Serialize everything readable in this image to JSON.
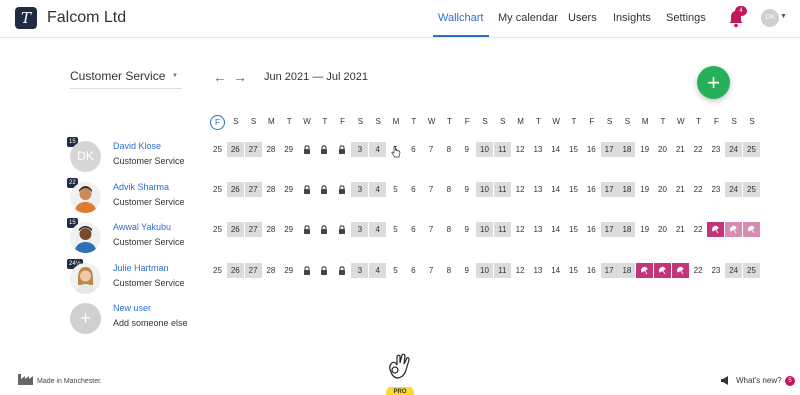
{
  "header": {
    "logo_letter": "T",
    "company": "Falcom Ltd",
    "nav": [
      {
        "label": "Wallchart",
        "active": true
      },
      {
        "label": "My calendar"
      },
      {
        "label": "Users"
      },
      {
        "label": "Insights"
      },
      {
        "label": "Settings"
      }
    ],
    "notifications_count": "4",
    "user_initials": "DK"
  },
  "controls": {
    "team": "Customer Service",
    "range": "Jun 2021 — Jul 2021"
  },
  "day_letters": [
    "F",
    "S",
    "S",
    "M",
    "T",
    "W",
    "T",
    "F",
    "S",
    "S",
    "M",
    "T",
    "W",
    "T",
    "F",
    "S",
    "S",
    "M",
    "T",
    "W",
    "T",
    "F",
    "S",
    "S",
    "M",
    "T",
    "W",
    "T",
    "F",
    "S",
    "S"
  ],
  "dates": [
    "25",
    "26",
    "27",
    "28",
    "29",
    "30",
    "1",
    "2",
    "3",
    "4",
    "5",
    "6",
    "7",
    "8",
    "9",
    "10",
    "11",
    "12",
    "13",
    "14",
    "15",
    "16",
    "17",
    "18",
    "19",
    "20",
    "21",
    "22",
    "23",
    "24",
    "25"
  ],
  "people": [
    {
      "name": "David Klose",
      "team": "Customer Service",
      "count": "15",
      "initials": "DK"
    },
    {
      "name": "Advik Sharma",
      "team": "Customer Service",
      "count": "22"
    },
    {
      "name": "Awwal Yakubu",
      "team": "Customer Service",
      "count": "15"
    },
    {
      "name": "Julie Hartman",
      "team": "Customer Service",
      "count": "24½"
    }
  ],
  "new_user": {
    "name": "New user",
    "sub": "Add someone else"
  },
  "footer": {
    "made_in": "Made in Manchester.",
    "pro": "PRO",
    "whats_new": "What's new?",
    "whats_new_count": "5"
  }
}
